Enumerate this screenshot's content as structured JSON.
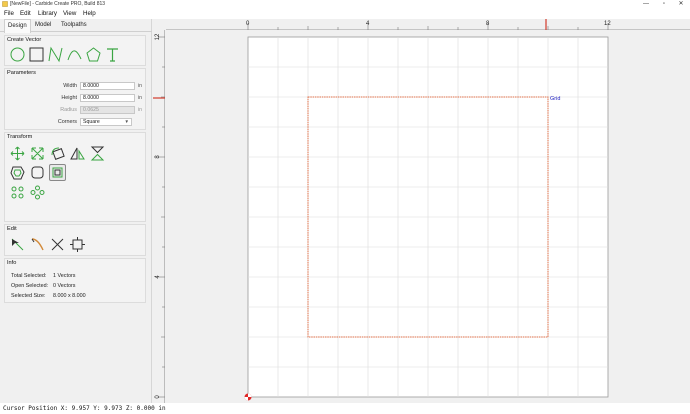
{
  "window": {
    "title": "[NewFile] - Carbide Create PRO, Build 813",
    "min_glyph": "—",
    "max_glyph": "▫",
    "close_glyph": "✕"
  },
  "menu": [
    "File",
    "Edit",
    "Library",
    "View",
    "Help"
  ],
  "tabs": [
    "Design",
    "Model",
    "Toolpaths"
  ],
  "create_vector": {
    "title": "Create Vector",
    "tools": [
      "circle-icon",
      "rectangle-icon",
      "polyline-icon",
      "curve-icon",
      "polygon-icon",
      "text-icon"
    ]
  },
  "parameters": {
    "title": "Parameters",
    "width_label": "Width",
    "width_value": "8.0000",
    "height_label": "Height",
    "height_value": "8.0000",
    "radius_label": "Radius",
    "radius_value": "0.0625",
    "corners_label": "Corners",
    "corners_value": "Square",
    "unit": "in"
  },
  "transform": {
    "title": "Transform",
    "row1": [
      "move-icon",
      "scale-icon",
      "rotate-icon",
      "mirror-icon",
      "flip-icon"
    ],
    "row2": [
      "offset-icon",
      "rounded-rect-icon",
      "fit-box-icon"
    ],
    "row3": [
      "align-icon",
      "array-icon"
    ]
  },
  "edit": {
    "title": "Edit",
    "tools": [
      "node-edit-icon",
      "knife-icon",
      "trim-icon",
      "boolean-icon"
    ]
  },
  "info": {
    "title": "Info",
    "total_selected_label": "Total Selected:",
    "total_selected_value": "1 Vectors",
    "open_selected_label": "Open Selected:",
    "open_selected_value": "0 Vectors",
    "selected_size_label": "Selected Size:",
    "selected_size_value": "8.000 x 8.000"
  },
  "ruler": {
    "top_labels": [
      "0",
      "4",
      "8",
      "12"
    ],
    "left_labels": [
      "12",
      "8",
      "4",
      "0"
    ]
  },
  "canvas": {
    "grid_label": "Grid",
    "accent_color": "#e0704a",
    "grid_label_color": "#2020c0"
  },
  "status": "Cursor Position X: 9.957 Y: 9.973 Z: 0.000 in"
}
